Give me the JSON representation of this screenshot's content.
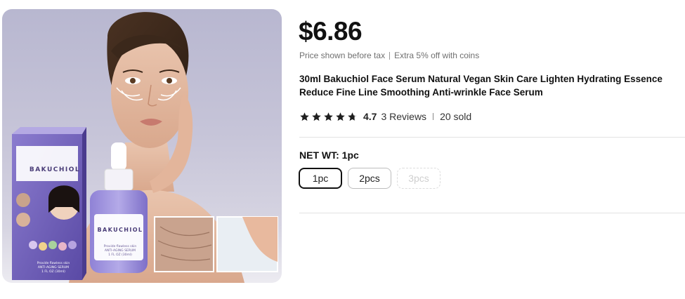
{
  "product_image": {
    "box_brand": "BAKUCHIOL",
    "box_subtext": [
      "Provide flawless skin",
      "ANTI-AGING SERUM",
      "1 FL OZ (30ml)"
    ],
    "bottle_brand": "BAKUCHIOL",
    "bottle_subtext": [
      "Provide flawless skin",
      "ANTI-AGING SERUM",
      "1 FL OZ (30ml)"
    ]
  },
  "price": {
    "value": "$6.86",
    "note_before_tax": "Price shown before tax",
    "note_coins": "Extra 5% off with coins"
  },
  "title": "30ml Bakuchiol Face Serum Natural Vegan Skin Care Lighten Hydrating Essence Reduce Fine Line Smoothing Anti-wrinkle Face Serum",
  "rating": {
    "stars": 4.7,
    "value": "4.7",
    "reviews": "3 Reviews",
    "sold": "20 sold"
  },
  "variant": {
    "label": "NET WT: 1pc",
    "options": [
      {
        "label": "1pc",
        "state": "selected"
      },
      {
        "label": "2pcs",
        "state": "available"
      },
      {
        "label": "3pcs",
        "state": "disabled"
      }
    ]
  },
  "colors": {
    "star": "#1f1f1f",
    "accent": "#111111",
    "packaging": "#6d5fb3"
  }
}
